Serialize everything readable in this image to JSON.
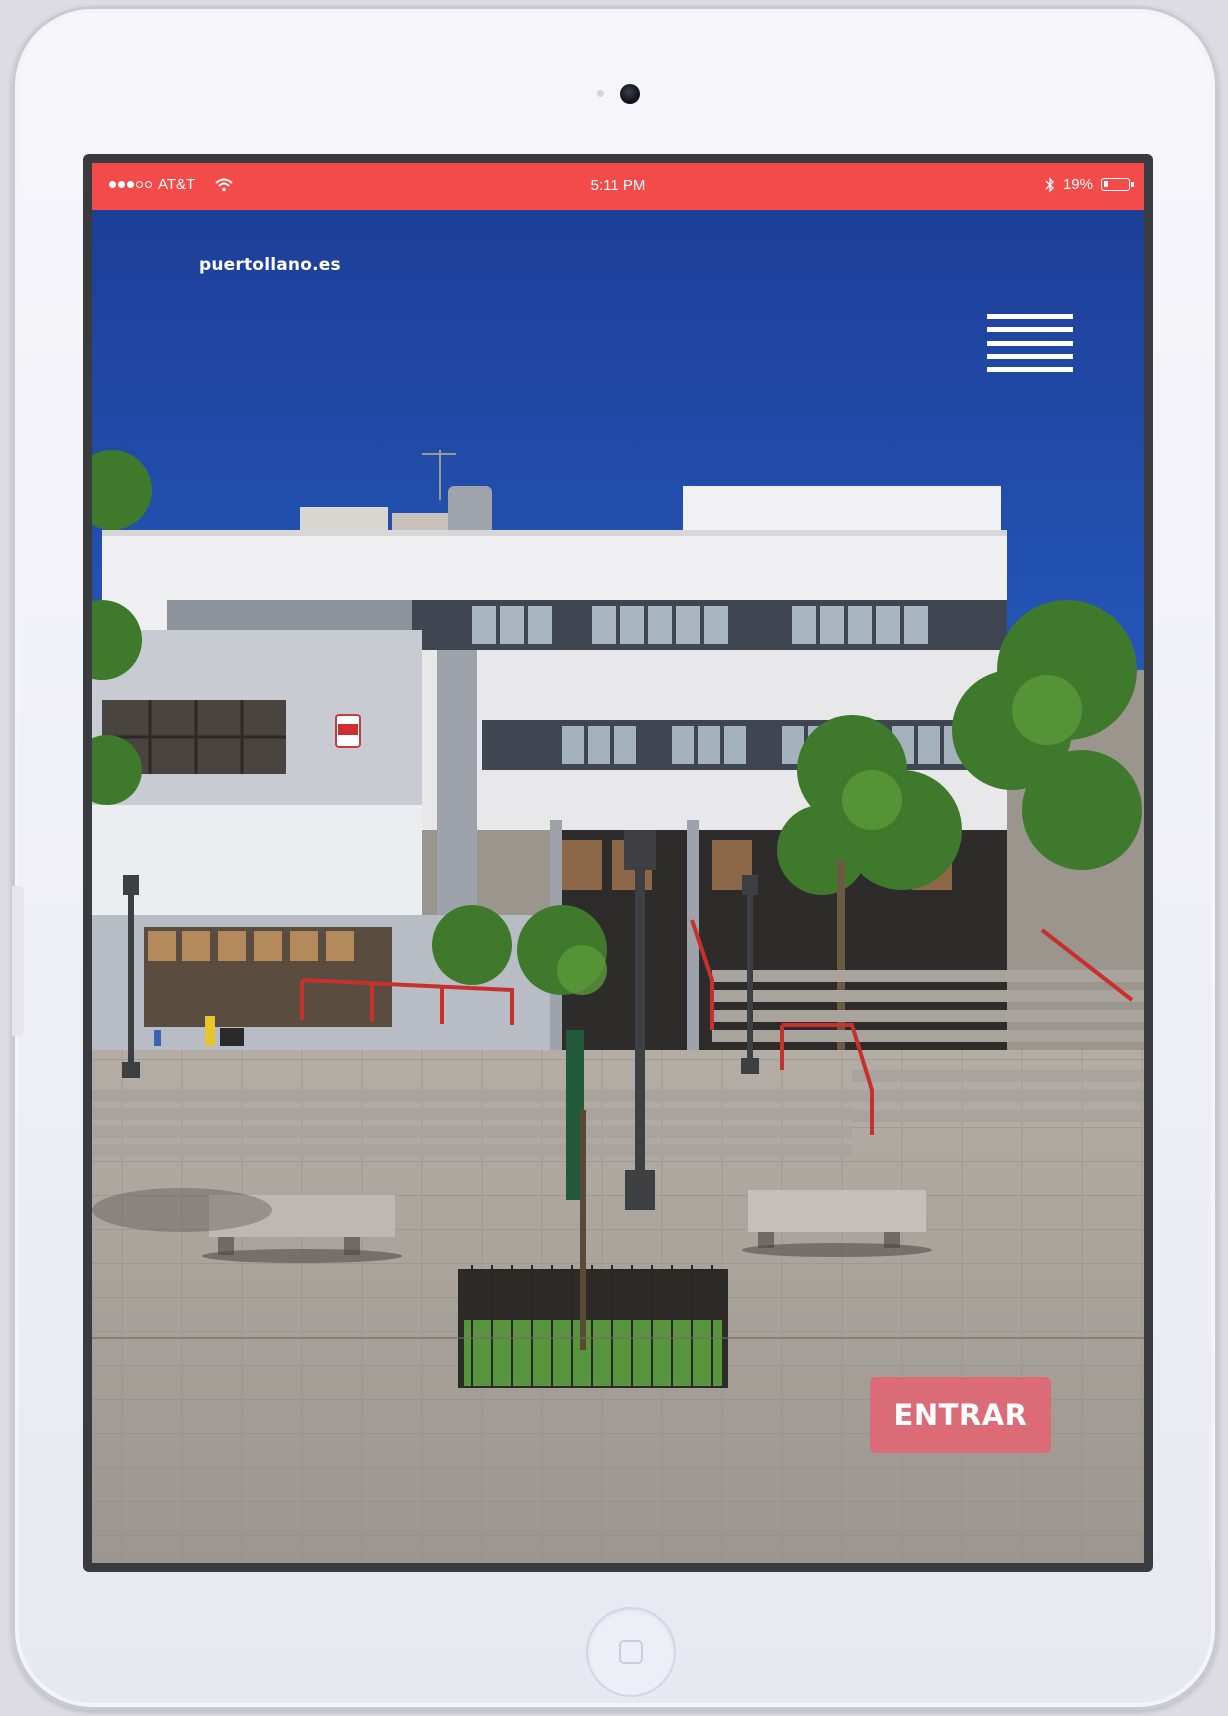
{
  "status_bar": {
    "carrier": "AT&T",
    "time": "5:11 PM",
    "battery": "19%",
    "battery_level": 0.19,
    "signal_bars_filled": 3,
    "signal_bars_total": 5
  },
  "app": {
    "site_title": "puertollano.es",
    "menu_icon": "hamburger-menu-icon",
    "enter_label": "ENTRAR"
  },
  "colors": {
    "status_bar": "#f24b49",
    "enter_button": "#e86070",
    "sky": "#1f47a8"
  }
}
